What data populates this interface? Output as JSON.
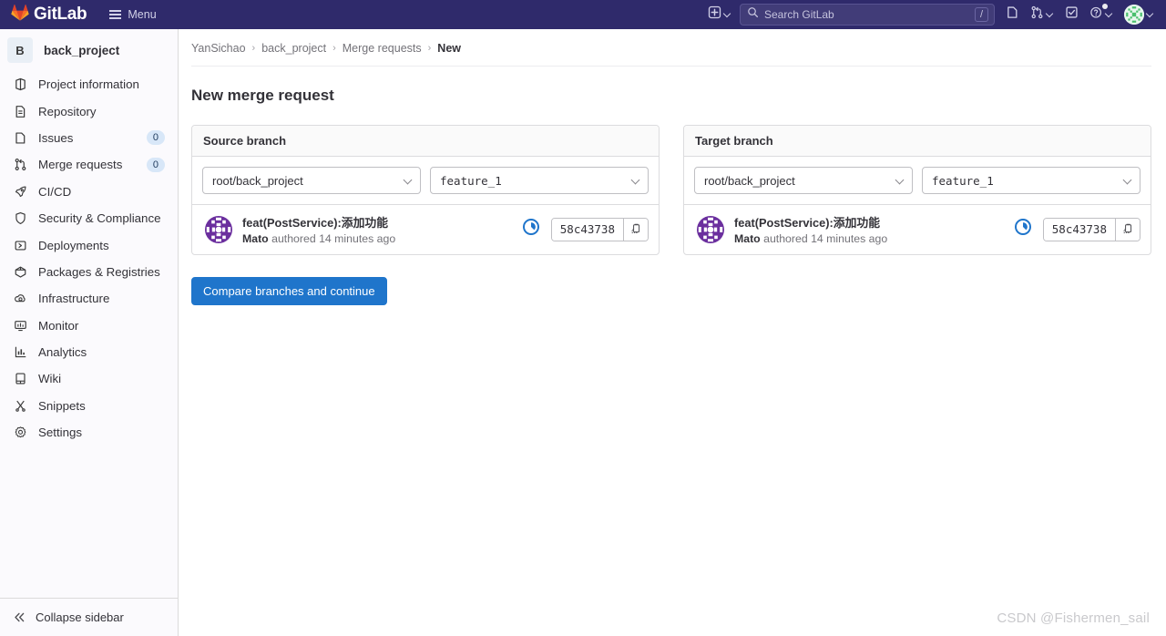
{
  "navbar": {
    "brand_name": "GitLab",
    "menu_label": "Menu",
    "search": {
      "placeholder": "Search GitLab",
      "shortcut_key": "/",
      "value": ""
    },
    "items": [
      {
        "name": "new-dropdown",
        "icon": "plus-square-icon",
        "has_chevron": true
      },
      {
        "name": "issues",
        "icon": "issues-icon",
        "has_chevron": false
      },
      {
        "name": "merge-requests",
        "icon": "merge-request-icon",
        "has_chevron": true
      },
      {
        "name": "todos",
        "icon": "todo-check-icon",
        "has_chevron": false
      },
      {
        "name": "help",
        "icon": "help-circle-icon",
        "has_chevron": true,
        "has_badge": true
      },
      {
        "name": "user-menu",
        "icon": "avatar",
        "has_chevron": true
      }
    ]
  },
  "sidebar": {
    "project": {
      "initial": "B",
      "name": "back_project"
    },
    "items": [
      {
        "label": "Project information",
        "icon": "project-info-icon",
        "badge": null
      },
      {
        "label": "Repository",
        "icon": "repository-icon",
        "badge": null
      },
      {
        "label": "Issues",
        "icon": "issues-icon",
        "badge": "0"
      },
      {
        "label": "Merge requests",
        "icon": "merge-request-icon",
        "badge": "0"
      },
      {
        "label": "CI/CD",
        "icon": "rocket-icon",
        "badge": null
      },
      {
        "label": "Security & Compliance",
        "icon": "shield-icon",
        "badge": null
      },
      {
        "label": "Deployments",
        "icon": "deployments-icon",
        "badge": null
      },
      {
        "label": "Packages & Registries",
        "icon": "package-icon",
        "badge": null
      },
      {
        "label": "Infrastructure",
        "icon": "infrastructure-icon",
        "badge": null
      },
      {
        "label": "Monitor",
        "icon": "monitor-icon",
        "badge": null
      },
      {
        "label": "Analytics",
        "icon": "analytics-icon",
        "badge": null
      },
      {
        "label": "Wiki",
        "icon": "wiki-icon",
        "badge": null
      },
      {
        "label": "Snippets",
        "icon": "snippets-icon",
        "badge": null
      },
      {
        "label": "Settings",
        "icon": "gear-icon",
        "badge": null
      }
    ],
    "collapse_label": "Collapse sidebar"
  },
  "breadcrumb": {
    "items": [
      {
        "label": "YanSichao",
        "current": false
      },
      {
        "label": "back_project",
        "current": false
      },
      {
        "label": "Merge requests",
        "current": false
      },
      {
        "label": "New",
        "current": true
      }
    ],
    "separator": "›"
  },
  "page": {
    "title": "New merge request",
    "compare_button": "Compare branches and continue"
  },
  "source_branch": {
    "heading": "Source branch",
    "project_select": "root/back_project",
    "branch_select": "feature_1",
    "commit": {
      "title": "feat(PostService):添加功能",
      "author": "Mato",
      "authored_text": "authored 14 minutes ago",
      "sha": "58c43738",
      "pipeline_status": "pending",
      "copy_icon": "copy-to-clipboard-icon"
    }
  },
  "target_branch": {
    "heading": "Target branch",
    "project_select": "root/back_project",
    "branch_select": "feature_1",
    "commit": {
      "title": "feat(PostService):添加功能",
      "author": "Mato",
      "authored_text": "authored 14 minutes ago",
      "sha": "58c43738",
      "pipeline_status": "pending",
      "copy_icon": "copy-to-clipboard-icon"
    }
  },
  "watermark": "CSDN @Fishermen_sail",
  "colors": {
    "navbar_bg": "#2f2a6b",
    "primary_button": "#1f75cb",
    "badge_bg": "#d8e7f8",
    "pipeline_pending": "#1f75cb",
    "identicon_purple": "#6b2f9e",
    "identicon_green": "#4ac06e"
  }
}
